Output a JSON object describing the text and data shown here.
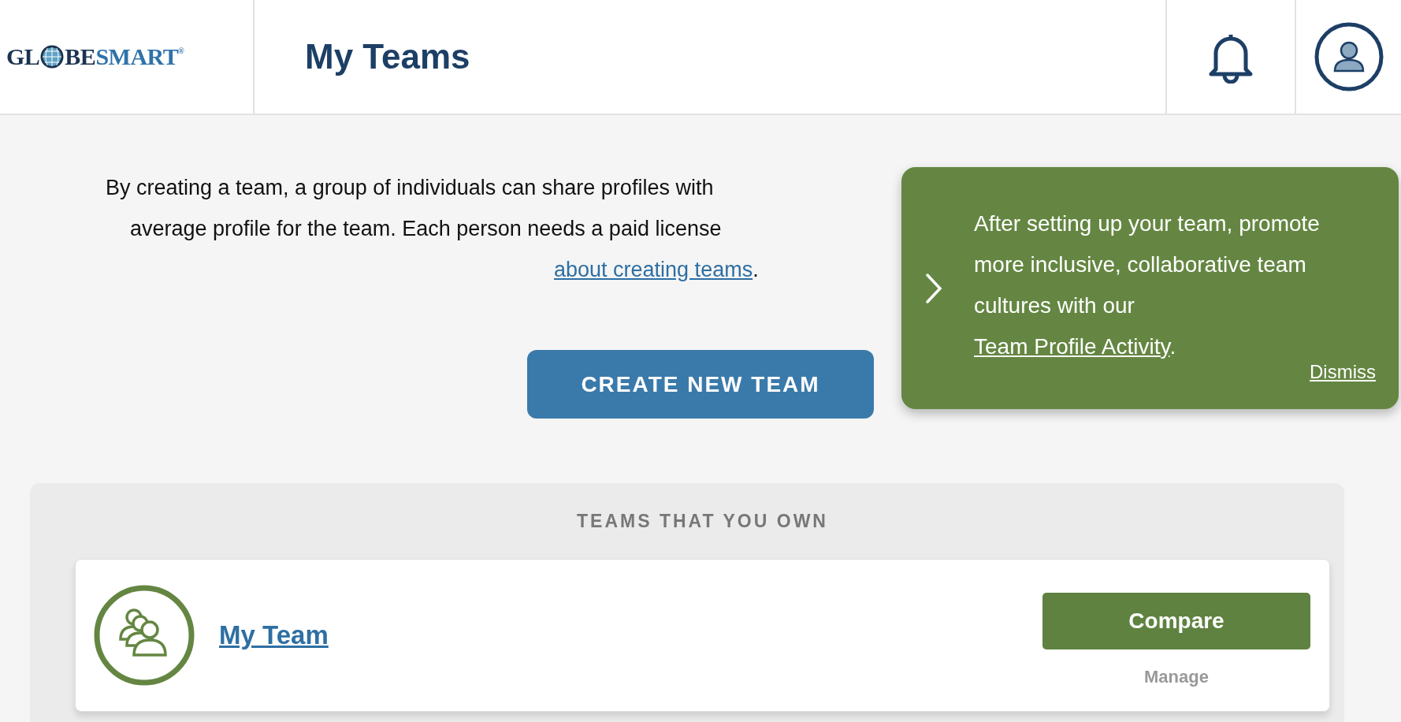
{
  "header": {
    "logo": {
      "text_1": "GL",
      "text_2": "BE",
      "text_3": "SMART",
      "mark": "®"
    },
    "title": "My Teams"
  },
  "intro": {
    "lines": [
      "By creating a team, a group of individuals can share profiles with",
      "average profile for the team. Each person needs a paid license"
    ],
    "link": "about creating teams",
    "after_link": "."
  },
  "create_button": "CREATE NEW TEAM",
  "popover": {
    "message": "After setting up your team, promote more inclusive, collaborative team cultures with our",
    "link": "Team Profile Activity",
    "after_link": ".",
    "dismiss": "Dismiss"
  },
  "teams_section": {
    "heading": "TEAMS THAT YOU OWN",
    "teams": [
      {
        "name": "My Team",
        "compare": "Compare",
        "manage": "Manage"
      }
    ]
  }
}
